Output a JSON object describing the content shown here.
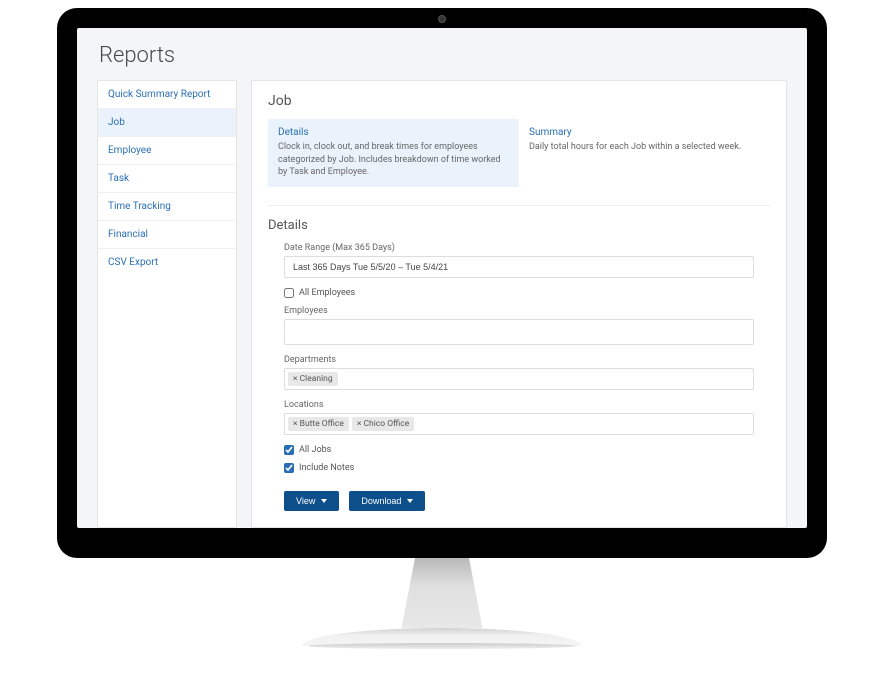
{
  "page": {
    "title": "Reports"
  },
  "sidebar": {
    "items": [
      {
        "label": "Quick Summary Report",
        "active": false
      },
      {
        "label": "Job",
        "active": true
      },
      {
        "label": "Employee",
        "active": false
      },
      {
        "label": "Task",
        "active": false
      },
      {
        "label": "Time Tracking",
        "active": false
      },
      {
        "label": "Financial",
        "active": false
      },
      {
        "label": "CSV Export",
        "active": false
      }
    ]
  },
  "main": {
    "heading": "Job",
    "cards": [
      {
        "title": "Details",
        "desc": "Clock in, clock out, and break times for employees categorized by Job. Includes breakdown of time worked by Task and Employee.",
        "active": true
      },
      {
        "title": "Summary",
        "desc": "Daily total hours for each Job within a selected week.",
        "active": false
      }
    ],
    "details": {
      "title": "Details",
      "date_range_label": "Date Range (Max 365 Days)",
      "date_range_value": "Last 365 Days Tue 5/5/20 – Tue 5/4/21",
      "all_employees_label": "All Employees",
      "all_employees_checked": false,
      "employees_label": "Employees",
      "employees_value": "",
      "departments_label": "Departments",
      "departments_tags": [
        "Cleaning"
      ],
      "locations_label": "Locations",
      "locations_tags": [
        "Butte Office",
        "Chico Office"
      ],
      "all_jobs_label": "All Jobs",
      "all_jobs_checked": true,
      "include_notes_label": "Include Notes",
      "include_notes_checked": true
    },
    "buttons": {
      "view": "View",
      "download": "Download"
    }
  }
}
